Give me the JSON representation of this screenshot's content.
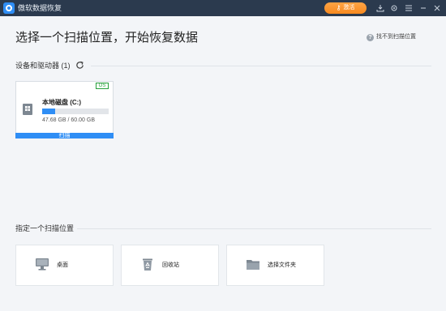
{
  "window": {
    "title": "傲软数据恢复",
    "activate_label": "激活",
    "brand_color": "#2f8ef5",
    "accent_color": "#f78a1f"
  },
  "header": {
    "title": "选择一个扫描位置，开始恢复数据",
    "help_link": "找不到扫描位置"
  },
  "devices": {
    "section_label": "设备和驱动器 (1)",
    "drives": [
      {
        "name": "本地磁盘 (C:)",
        "badge": "OS",
        "size_text": "47.68 GB / 60.00 GB",
        "used_fraction": 0.2,
        "scan_label": "扫描"
      }
    ]
  },
  "locations": {
    "section_label": "指定一个扫描位置",
    "items": [
      {
        "label": "桌面",
        "icon": "desktop-icon"
      },
      {
        "label": "回收站",
        "icon": "recycle-bin-icon"
      },
      {
        "label": "选择文件夹",
        "icon": "folder-icon"
      }
    ]
  }
}
